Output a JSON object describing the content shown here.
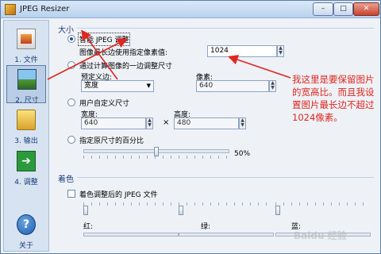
{
  "window": {
    "title": "JPEG Resizer",
    "controls": {
      "minimize": "–",
      "maximize": "□",
      "close": "✕"
    }
  },
  "sidebar": {
    "items": [
      {
        "label": "1. 文件",
        "icon": "file-icon"
      },
      {
        "label": "2. 尺寸",
        "icon": "size-icon"
      },
      {
        "label": "3. 输出",
        "icon": "output-icon"
      },
      {
        "label": "4. 调整",
        "icon": "adjust-icon"
      },
      {
        "label": "关于",
        "icon": "help-icon"
      }
    ],
    "active": "2. 尺寸"
  },
  "size_section": {
    "title": "大小",
    "smart": {
      "label": "智能 JPEG 调整",
      "longest_label": "图像最长边使用指定像素值:",
      "longest_value": "1024"
    },
    "one_side": {
      "label": "通过计算图像的一边调整尺寸",
      "preset_label": "预定义边:",
      "preset_value": "宽度",
      "pixels_label": "像素:",
      "pixels_value": "640"
    },
    "custom": {
      "label": "用户自定义尺寸",
      "width_label": "宽度:",
      "width_value": "640",
      "times": "×",
      "height_label": "高度:",
      "height_value": "480"
    },
    "percent": {
      "label": "指定原尺寸的百分比",
      "value_label": "50%",
      "value": 50
    }
  },
  "tint_section": {
    "title": "着色",
    "checkbox_label": "着色调整后的 JPEG 文件",
    "red_label": "红:",
    "green_label": "绿:",
    "blue_label": "蓝:"
  },
  "annotation": {
    "text": "我这里是要保留图片的宽高比。而且我设置图片最长边不超过1024像素。",
    "color": "#e0261f"
  },
  "watermark": "Baidu 经验"
}
